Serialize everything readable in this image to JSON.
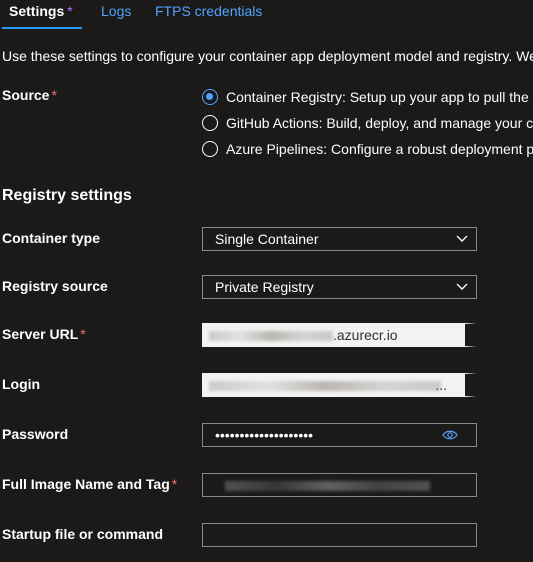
{
  "tabs": [
    {
      "label": "Settings",
      "modified_marker": "*",
      "active": true
    },
    {
      "label": "Logs",
      "active": false
    },
    {
      "label": "FTPS credentials",
      "active": false
    }
  ],
  "description": "Use these settings to configure your container app deployment model and registry. We",
  "source": {
    "label": "Source",
    "required_marker": "*",
    "options": [
      {
        "label": "Container Registry: Setup up your app to pull the",
        "checked": true
      },
      {
        "label": "GitHub Actions: Build, deploy, and manage your c",
        "checked": false
      },
      {
        "label": "Azure Pipelines: Configure a robust deployment p",
        "checked": false
      }
    ]
  },
  "registry_settings": {
    "heading": "Registry settings",
    "container_type": {
      "label": "Container type",
      "value": "Single Container",
      "icon": "chevron-down-icon"
    },
    "registry_source": {
      "label": "Registry source",
      "value": "Private Registry",
      "icon": "chevron-down-icon"
    },
    "server_url": {
      "label": "Server URL",
      "required_marker": "*",
      "value_suffix": ".azurecr.io"
    },
    "login": {
      "label": "Login",
      "value_suffix": "..."
    },
    "password": {
      "label": "Password",
      "value": "••••••••••••••••••••",
      "icon": "eye-icon"
    },
    "image_name": {
      "label": "Full Image Name and Tag",
      "required_marker": "*"
    },
    "startup": {
      "label": "Startup file or command",
      "value": ""
    }
  },
  "colors": {
    "background": "#1b1a19",
    "accent": "#2899f5",
    "link": "#4fa3ff",
    "required": "#ff6b6b",
    "modified": "#c56bff",
    "border": "#8a8886"
  }
}
